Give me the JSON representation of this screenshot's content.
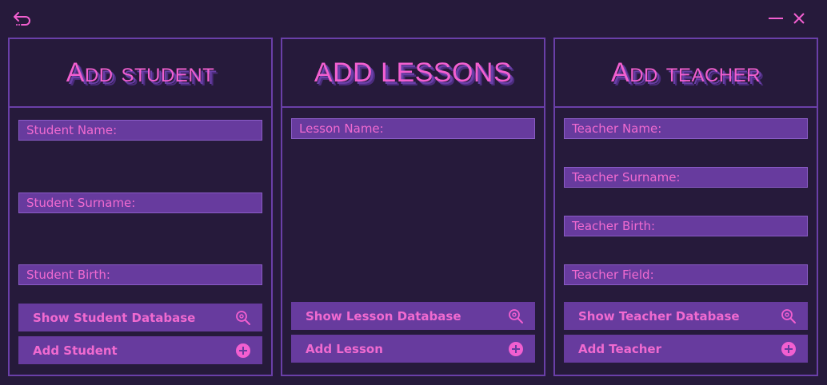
{
  "colors": {
    "background": "#261a3b",
    "panel_border": "#6a3fa8",
    "field_fill": "#673b9e",
    "accent_pink": "#f25fd0"
  },
  "titlebar": {
    "back_icon": "back-arrow-icon",
    "minimize_icon": "minimize-icon",
    "close_icon": "close-icon"
  },
  "student": {
    "title": "Add student",
    "name_placeholder": "Student Name:",
    "surname_placeholder": "Student Surname:",
    "birth_placeholder": "Student Birth:",
    "show_label": "Show Student Database",
    "add_label": "Add Student"
  },
  "lessons": {
    "title": "ADD LESSONS",
    "name_placeholder": "Lesson Name:",
    "show_label": "Show Lesson Database",
    "add_label": "Add Lesson"
  },
  "teacher": {
    "title": "Add teacher",
    "name_placeholder": "Teacher Name:",
    "surname_placeholder": "Teacher Surname:",
    "birth_placeholder": "Teacher Birth:",
    "field_placeholder": "Teacher Field:",
    "show_label": "Show Teacher Database",
    "add_label": "Add Teacher"
  },
  "icons": {
    "search": "search-zoom-icon",
    "add": "plus-circle-icon"
  }
}
